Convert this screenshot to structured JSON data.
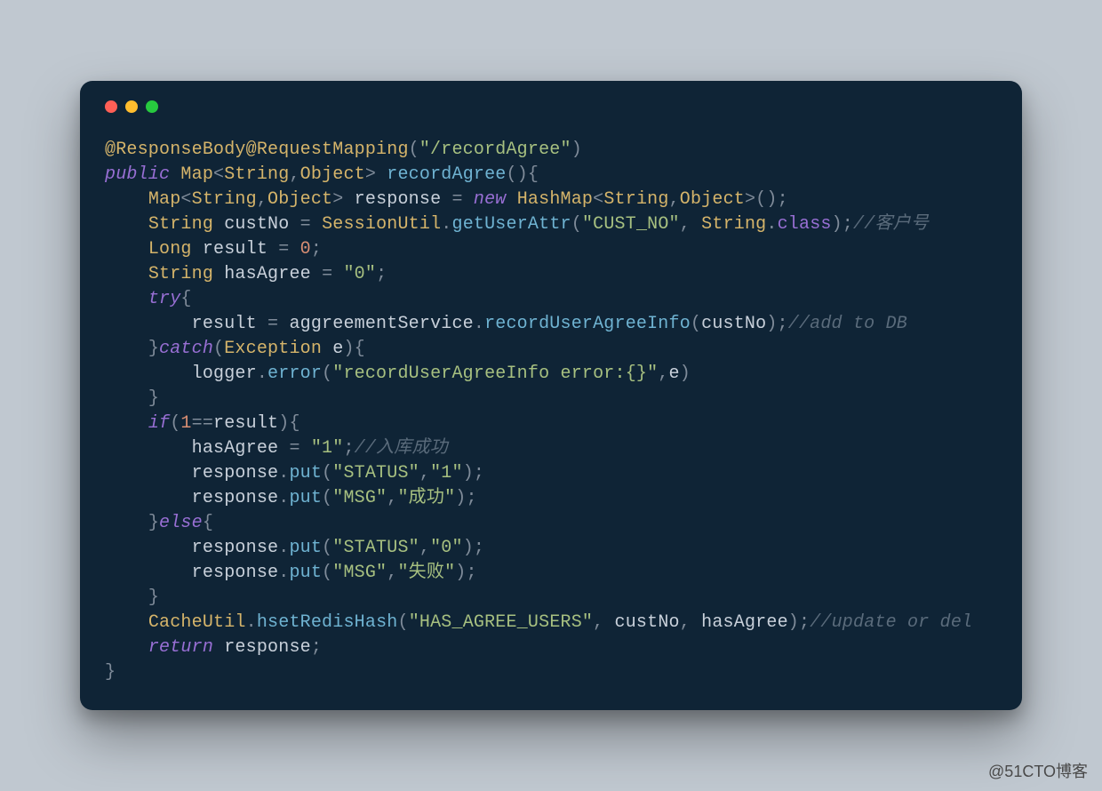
{
  "watermark": "@51CTO博客",
  "colors": {
    "page_bg": "#c0c8d0",
    "window_bg": "#0f2436",
    "dot_red": "#ff5f56",
    "dot_yellow": "#ffbd2e",
    "dot_green": "#27c93f",
    "keyword": "#986fd4",
    "type": "#d5b46a",
    "string": "#a7c080",
    "number": "#d88e73",
    "comment": "#5a6b7b",
    "function": "#6fb3d2",
    "default": "#c8d0da",
    "punct": "#7f8b99"
  },
  "code": {
    "tokens": [
      [
        [
          "ann",
          "@ResponseBody@RequestMapping"
        ],
        [
          "punc",
          "("
        ],
        [
          "str",
          "\"/recordAgree\""
        ],
        [
          "punc",
          ")"
        ]
      ],
      [
        [
          "kw",
          "public"
        ],
        [
          "id",
          " "
        ],
        [
          "type",
          "Map"
        ],
        [
          "punc",
          "<"
        ],
        [
          "type",
          "String"
        ],
        [
          "punc",
          ","
        ],
        [
          "type",
          "Object"
        ],
        [
          "punc",
          "> "
        ],
        [
          "fn",
          "recordAgree"
        ],
        [
          "punc",
          "(){"
        ]
      ],
      [
        [
          "id",
          "    "
        ],
        [
          "type",
          "Map"
        ],
        [
          "punc",
          "<"
        ],
        [
          "type",
          "String"
        ],
        [
          "punc",
          ","
        ],
        [
          "type",
          "Object"
        ],
        [
          "punc",
          "> "
        ],
        [
          "id",
          "response "
        ],
        [
          "op",
          "= "
        ],
        [
          "kw",
          "new"
        ],
        [
          "id",
          " "
        ],
        [
          "type",
          "HashMap"
        ],
        [
          "punc",
          "<"
        ],
        [
          "type",
          "String"
        ],
        [
          "punc",
          ","
        ],
        [
          "type",
          "Object"
        ],
        [
          "punc",
          ">();"
        ]
      ],
      [
        [
          "id",
          "    "
        ],
        [
          "type",
          "String"
        ],
        [
          "id",
          " custNo "
        ],
        [
          "op",
          "= "
        ],
        [
          "type",
          "SessionUtil"
        ],
        [
          "punc",
          "."
        ],
        [
          "fn",
          "getUserAttr"
        ],
        [
          "punc",
          "("
        ],
        [
          "str",
          "\"CUST_NO\""
        ],
        [
          "punc",
          ", "
        ],
        [
          "type",
          "String"
        ],
        [
          "punc",
          "."
        ],
        [
          "kwn",
          "class"
        ],
        [
          "punc",
          ");"
        ],
        [
          "cmt",
          "//客户号"
        ]
      ],
      [
        [
          "id",
          "    "
        ],
        [
          "type",
          "Long"
        ],
        [
          "id",
          " result "
        ],
        [
          "op",
          "= "
        ],
        [
          "num",
          "0"
        ],
        [
          "punc",
          ";"
        ]
      ],
      [
        [
          "id",
          "    "
        ],
        [
          "type",
          "String"
        ],
        [
          "id",
          " hasAgree "
        ],
        [
          "op",
          "= "
        ],
        [
          "str",
          "\"0\""
        ],
        [
          "punc",
          ";"
        ]
      ],
      [
        [
          "id",
          "    "
        ],
        [
          "kw",
          "try"
        ],
        [
          "punc",
          "{"
        ]
      ],
      [
        [
          "id",
          "        result "
        ],
        [
          "op",
          "= "
        ],
        [
          "id",
          "aggreementService"
        ],
        [
          "punc",
          "."
        ],
        [
          "fn",
          "recordUserAgreeInfo"
        ],
        [
          "punc",
          "("
        ],
        [
          "id",
          "custNo"
        ],
        [
          "punc",
          ");"
        ],
        [
          "cmt",
          "//add to DB"
        ]
      ],
      [
        [
          "id",
          "    "
        ],
        [
          "punc",
          "}"
        ],
        [
          "kw",
          "catch"
        ],
        [
          "punc",
          "("
        ],
        [
          "type",
          "Exception"
        ],
        [
          "id",
          " e"
        ],
        [
          "punc",
          "){"
        ]
      ],
      [
        [
          "id",
          "        logger"
        ],
        [
          "punc",
          "."
        ],
        [
          "fn",
          "error"
        ],
        [
          "punc",
          "("
        ],
        [
          "str",
          "\"recordUserAgreeInfo error:{}\""
        ],
        [
          "punc",
          ","
        ],
        [
          "id",
          "e"
        ],
        [
          "punc",
          ")"
        ]
      ],
      [
        [
          "id",
          "    "
        ],
        [
          "punc",
          "}"
        ]
      ],
      [
        [
          "id",
          "    "
        ],
        [
          "kw",
          "if"
        ],
        [
          "punc",
          "("
        ],
        [
          "num",
          "1"
        ],
        [
          "op",
          "=="
        ],
        [
          "id",
          "result"
        ],
        [
          "punc",
          "){"
        ]
      ],
      [
        [
          "id",
          "        hasAgree "
        ],
        [
          "op",
          "= "
        ],
        [
          "str",
          "\"1\""
        ],
        [
          "punc",
          ";"
        ],
        [
          "cmt",
          "//入库成功"
        ]
      ],
      [
        [
          "id",
          "        response"
        ],
        [
          "punc",
          "."
        ],
        [
          "fn",
          "put"
        ],
        [
          "punc",
          "("
        ],
        [
          "str",
          "\"STATUS\""
        ],
        [
          "punc",
          ","
        ],
        [
          "str",
          "\"1\""
        ],
        [
          "punc",
          ");"
        ]
      ],
      [
        [
          "id",
          "        response"
        ],
        [
          "punc",
          "."
        ],
        [
          "fn",
          "put"
        ],
        [
          "punc",
          "("
        ],
        [
          "str",
          "\"MSG\""
        ],
        [
          "punc",
          ","
        ],
        [
          "str",
          "\"成功\""
        ],
        [
          "punc",
          ");"
        ]
      ],
      [
        [
          "id",
          "    "
        ],
        [
          "punc",
          "}"
        ],
        [
          "kw",
          "else"
        ],
        [
          "punc",
          "{"
        ]
      ],
      [
        [
          "id",
          "        response"
        ],
        [
          "punc",
          "."
        ],
        [
          "fn",
          "put"
        ],
        [
          "punc",
          "("
        ],
        [
          "str",
          "\"STATUS\""
        ],
        [
          "punc",
          ","
        ],
        [
          "str",
          "\"0\""
        ],
        [
          "punc",
          ");"
        ]
      ],
      [
        [
          "id",
          "        response"
        ],
        [
          "punc",
          "."
        ],
        [
          "fn",
          "put"
        ],
        [
          "punc",
          "("
        ],
        [
          "str",
          "\"MSG\""
        ],
        [
          "punc",
          ","
        ],
        [
          "str",
          "\"失败\""
        ],
        [
          "punc",
          ");"
        ]
      ],
      [
        [
          "id",
          "    "
        ],
        [
          "punc",
          "}"
        ]
      ],
      [
        [
          "id",
          "    "
        ],
        [
          "type",
          "CacheUtil"
        ],
        [
          "punc",
          "."
        ],
        [
          "fn",
          "hsetRedisHash"
        ],
        [
          "punc",
          "("
        ],
        [
          "str",
          "\"HAS_AGREE_USERS\""
        ],
        [
          "punc",
          ", "
        ],
        [
          "id",
          "custNo"
        ],
        [
          "punc",
          ", "
        ],
        [
          "id",
          "hasAgree"
        ],
        [
          "punc",
          ");"
        ],
        [
          "cmt",
          "//update or del"
        ]
      ],
      [
        [
          "id",
          "    "
        ],
        [
          "kw",
          "return"
        ],
        [
          "id",
          " response"
        ],
        [
          "punc",
          ";"
        ]
      ],
      [
        [
          "punc",
          "}"
        ]
      ]
    ]
  }
}
